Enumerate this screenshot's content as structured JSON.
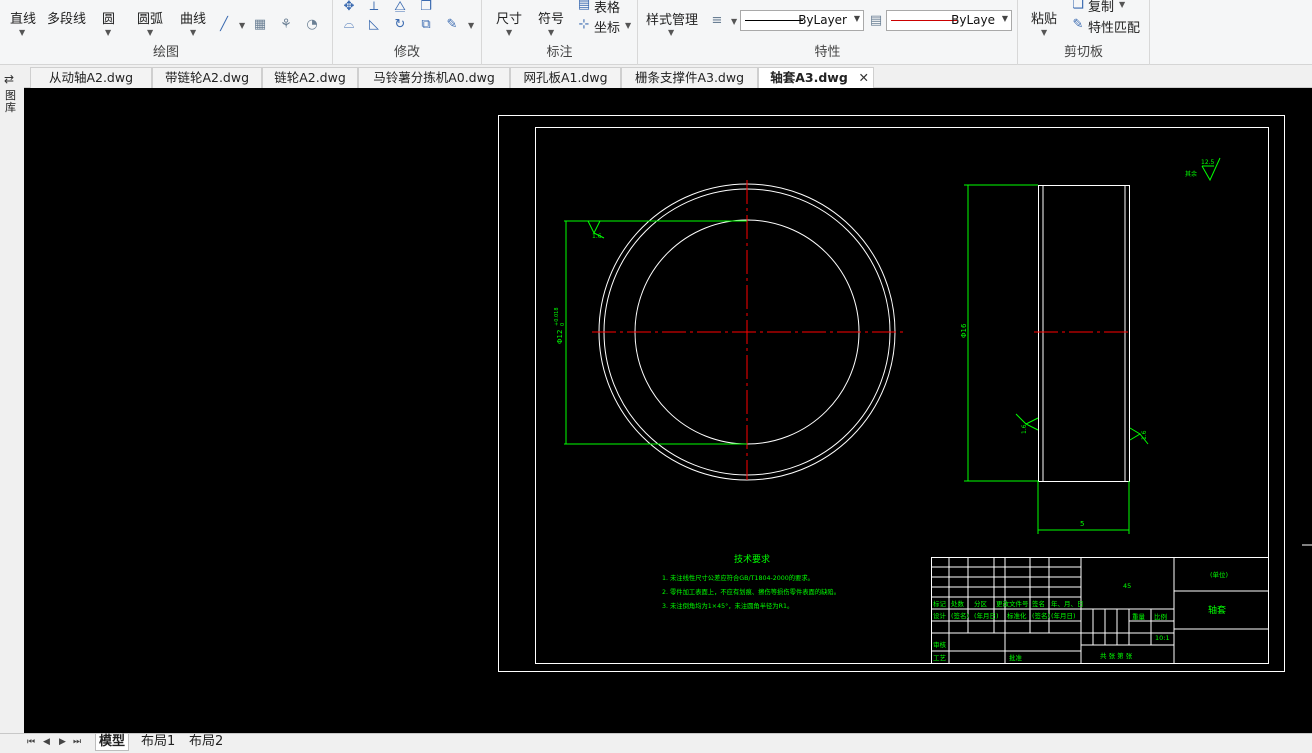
{
  "ribbon": {
    "draw_panel": {
      "title": "绘图",
      "tools": {
        "line": "直线",
        "polyline": "多段线",
        "circle": "圆",
        "arc": "圆弧",
        "curve": "曲线"
      }
    },
    "modify_panel": {
      "title": "修改"
    },
    "annotate_panel": {
      "title": "标注",
      "tools": {
        "dimension": "尺寸",
        "symbol": "符号",
        "table": "表格",
        "coordinate": "坐标"
      }
    },
    "properties_panel": {
      "title": "特性",
      "style_manager": "样式管理",
      "linetype_value": "ByLayer",
      "color_value": "ByLaye",
      "linetype_color": "#000000",
      "color_swatch": "#cc0000"
    },
    "clipboard_panel": {
      "title": "剪切板",
      "paste": "粘贴",
      "copy": "复制",
      "match_properties": "特性匹配"
    }
  },
  "side_toolbar": {
    "label": "图库"
  },
  "tabs": [
    {
      "label": "从动轴A2.dwg",
      "active": false
    },
    {
      "label": "带链轮A2.dwg",
      "active": false
    },
    {
      "label": "链轮A2.dwg",
      "active": false
    },
    {
      "label": "马铃薯分拣机A0.dwg",
      "active": false
    },
    {
      "label": "网孔板A1.dwg",
      "active": false
    },
    {
      "label": "栅条支撑件A3.dwg",
      "active": false
    },
    {
      "label": "轴套A3.dwg",
      "active": true
    }
  ],
  "tab_close_glyph": "✕",
  "drawing": {
    "colors": {
      "frame": "#ffffff",
      "dimension": "#00ff00",
      "centerline": "#ff0000",
      "text": "#00ff00"
    },
    "dim_left_diameter": "Φ12",
    "dim_left_tolerance": "+0.018\n0",
    "dim_right_diameter": "Φ16",
    "dim_width": "5",
    "rough_left": "1.6",
    "rough_right_a": "1.6",
    "rough_right_b": "1.6",
    "rough_other_label": "其余",
    "rough_other_value": "12.5",
    "tech_req_title": "技术要求",
    "tech_req_items": [
      "1. 未注线性尺寸公差应符合GB/T1804-2000的要求。",
      "2. 零件加工表面上，不应有划痕、擦伤等损伤零件表面的缺陷。",
      "3. 未注倒角均为1×45°，未注圆角半径为R1。"
    ],
    "title_block": {
      "material": "45",
      "unit": "(单位)",
      "part_name": "轴套",
      "scale": "10:1",
      "scale_label": "比例",
      "weight_label": "重量",
      "sheets_label": "共  张  第  张",
      "header_row": [
        "标记",
        "处数",
        "分区",
        "更改文件号",
        "签名",
        "年、月、日"
      ],
      "design_row": [
        "设计",
        "(签名)",
        "(年月日)",
        "标准化",
        "(签名)",
        "(年月日)"
      ],
      "review_label": "审核",
      "process_label": "工艺",
      "approve_label": "批准"
    }
  },
  "layout_tabs": [
    {
      "label": "模型",
      "active": true
    },
    {
      "label": "布局1",
      "active": false
    },
    {
      "label": "布局2",
      "active": false
    }
  ],
  "nav_buttons": [
    "⏮",
    "◀",
    "▶",
    "⏭"
  ]
}
